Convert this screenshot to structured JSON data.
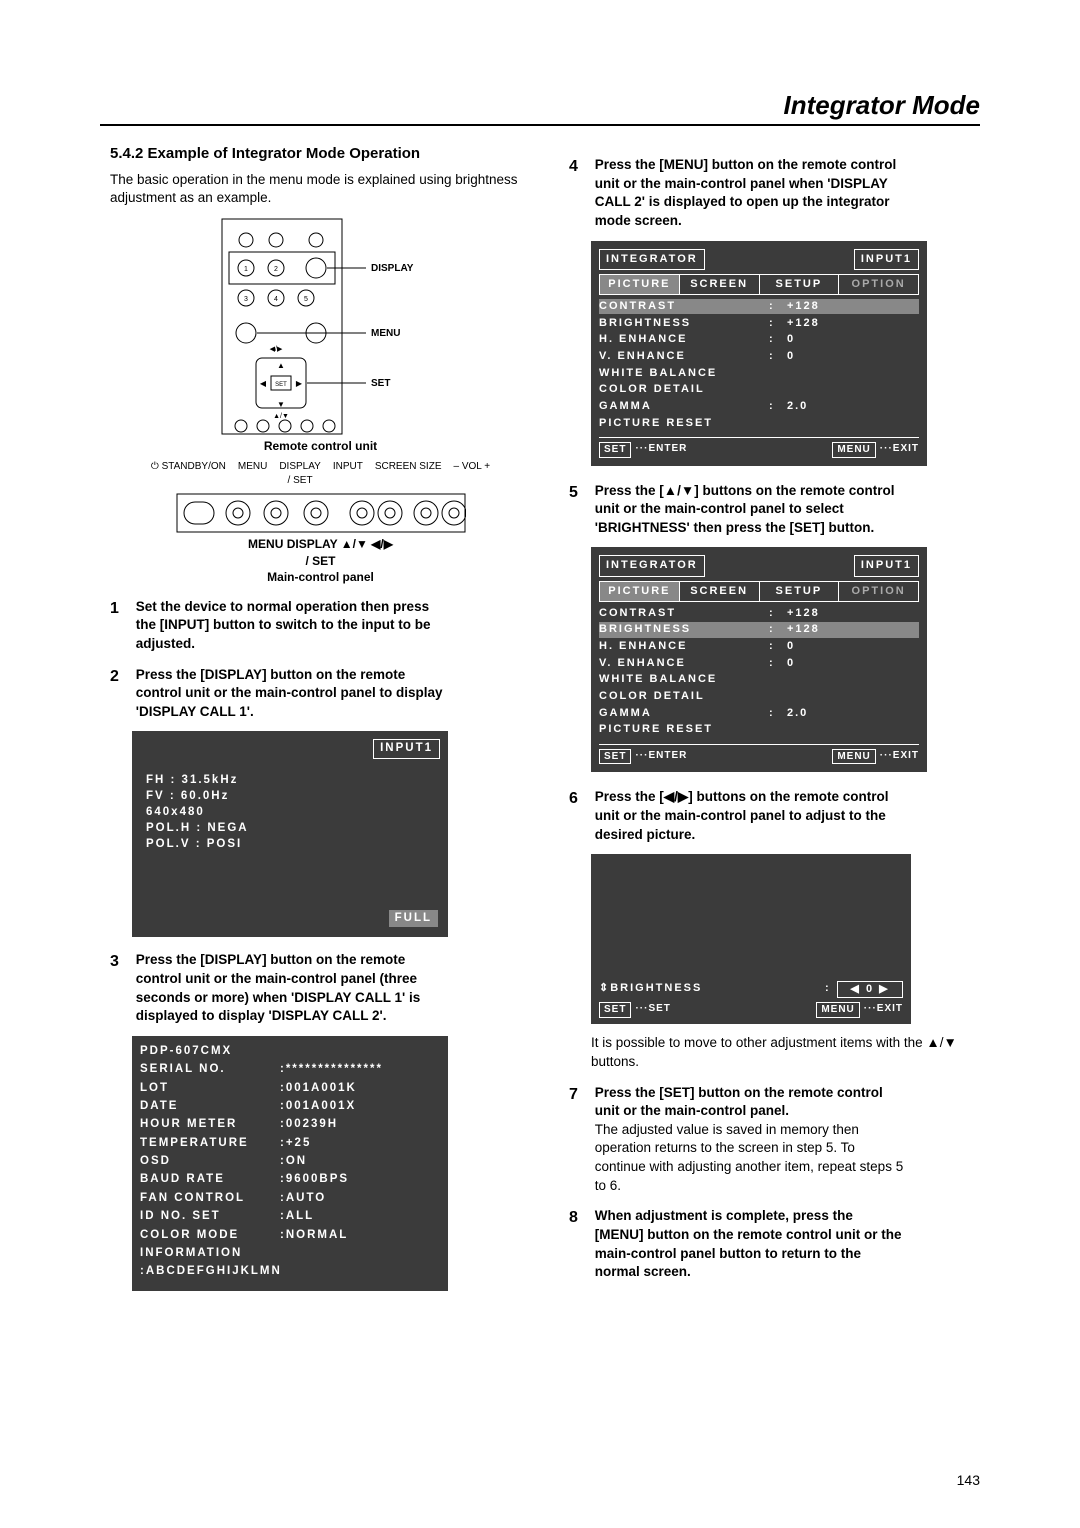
{
  "chapter": "Integrator Mode",
  "page_number": "143",
  "left": {
    "heading": "5.4.2 Example of Integrator Mode Operation",
    "intro": "The basic operation in the menu mode is explained using brightness adjustment as an example.",
    "remote_labels": {
      "display": "DISPLAY",
      "menu": "MENU",
      "set": "SET",
      "caption": "Remote control unit"
    },
    "main_labels": {
      "row": "MENU DISPLAY    ▲/▼    ◀/▶",
      "row2": "/ SET",
      "caption": "Main-control panel",
      "standby": "STANDBY/ON",
      "menu": "MENU",
      "display_set": "DISPLAY\n/ SET",
      "input": "INPUT",
      "screen": "SCREEN SIZE",
      "vol": "– VOL +"
    },
    "step1": "Set the device to normal operation then press the [INPUT] button to switch to the input to be adjusted.",
    "step2": "Press the [DISPLAY] button on the remote control unit or the main-control panel to display 'DISPLAY CALL 1'.",
    "panelC": {
      "input": "INPUT1",
      "lines": [
        "FH : 31.5kHz",
        "FV : 60.0Hz",
        "640x480",
        "POL.H : NEGA",
        "POL.V : POSI"
      ],
      "full": "FULL"
    },
    "step3": "Press the [DISPLAY] button on the remote control unit or the main-control panel (three seconds or more) when 'DISPLAY CALL 1' is displayed to display 'DISPLAY CALL 2'.",
    "panelD": {
      "model": "PDP-607CMX",
      "rows": [
        [
          "SERIAL NO.",
          ":***************"
        ],
        [
          "LOT",
          ":001A001K"
        ],
        [
          "DATE",
          ":001A001X"
        ],
        [
          "HOUR METER",
          ":00239H"
        ],
        [
          "TEMPERATURE",
          ":+25"
        ],
        [
          "OSD",
          ":ON"
        ],
        [
          "BAUD RATE",
          ":9600BPS"
        ],
        [
          "FAN CONTROL",
          ":AUTO"
        ],
        [
          "ID NO. SET",
          ":ALL"
        ],
        [
          "COLOR MODE",
          ":NORMAL"
        ],
        [
          "INFORMATION",
          ""
        ],
        [
          ":ABCDEFGHIJKLMN",
          ""
        ]
      ]
    }
  },
  "right": {
    "step4": "Press the [MENU] button on the remote control unit or the main-control panel when 'DISPLAY CALL 2' is displayed to open up the integrator mode screen.",
    "osd": {
      "title": "INTEGRATOR",
      "input": "INPUT1",
      "tabs": [
        "PICTURE",
        "SCREEN",
        "SETUP",
        "OPTION"
      ],
      "rows": [
        [
          "CONTRAST",
          "+128"
        ],
        [
          "BRIGHTNESS",
          "+128"
        ],
        [
          "H. ENHANCE",
          "0"
        ],
        [
          "V. ENHANCE",
          "0"
        ],
        [
          "WHITE BALANCE",
          ""
        ],
        [
          "COLOR DETAIL",
          ""
        ],
        [
          "GAMMA",
          "2.0"
        ],
        [
          "PICTURE RESET",
          ""
        ]
      ],
      "footer_set": "SET",
      "footer_enter": "···ENTER",
      "footer_menu": "MENU",
      "footer_exit": "···EXIT"
    },
    "step5": "Press the [▲/▼] buttons on the remote control unit or the main-control panel to select 'BRIGHTNESS' then press the [SET] button.",
    "step6": "Press the [◀/▶] buttons on the remote control unit or the main-control panel to adjust to the desired picture.",
    "osdAdj": {
      "label": "BRIGHTNESS",
      "val": "◀    0 ▶",
      "set": "SET",
      "set2": "···SET",
      "menu": "MENU",
      "exit": "···EXIT",
      "arrows": "⇕"
    },
    "note6": "It is possible to move to other adjustment items with the ▲/▼ buttons.",
    "step7_b": "Press the [SET] button on the remote control unit or the main-control panel.",
    "step7_p": "The adjusted value is saved in memory then operation returns to the screen in step 5. To continue with adjusting another item, repeat steps 5 to 6.",
    "step8": "When adjustment is complete, press the [MENU] button on the remote control unit or the main-control panel button to return to the normal screen."
  }
}
